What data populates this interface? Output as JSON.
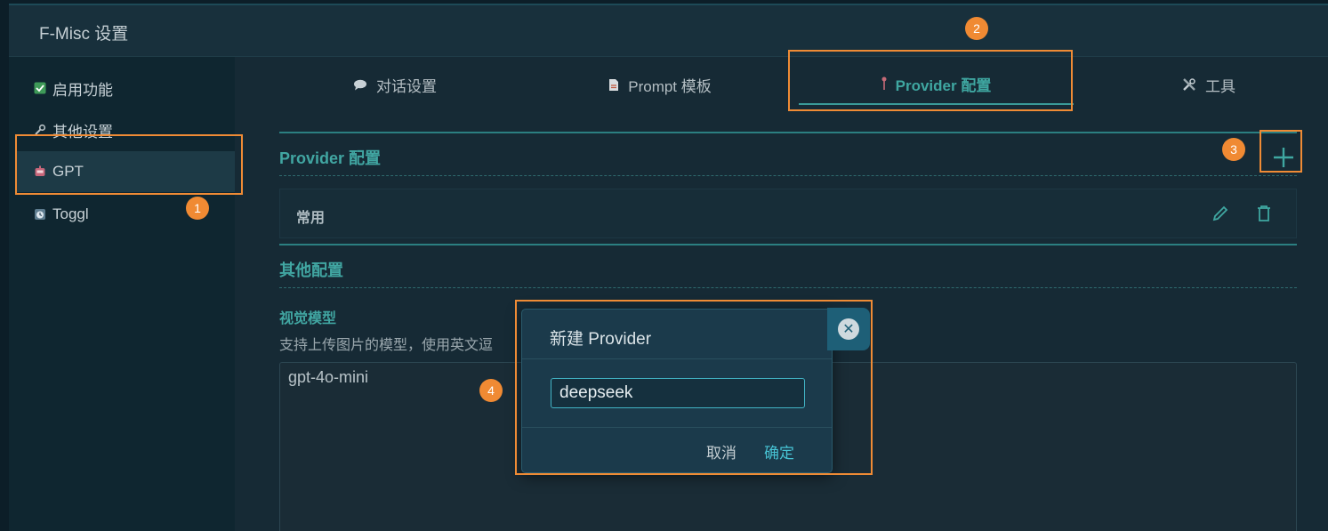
{
  "window": {
    "title": "F-Misc 设置"
  },
  "sidebar": {
    "items": [
      {
        "label": "启用功能",
        "icon": "checkbox-icon"
      },
      {
        "label": "其他设置",
        "icon": "wrench-icon"
      },
      {
        "label": "GPT",
        "icon": "robot-icon",
        "active": true
      },
      {
        "label": "Toggl",
        "icon": "clock-icon"
      }
    ]
  },
  "tabs": [
    {
      "label": "对话设置",
      "icon": "speech-bubble-icon"
    },
    {
      "label": "Prompt 模板",
      "icon": "document-icon"
    },
    {
      "label": "Provider 配置",
      "icon": "key-icon",
      "active": true
    },
    {
      "label": "工具",
      "icon": "tools-icon"
    }
  ],
  "provider_section": {
    "title": "Provider 配置",
    "providers": [
      {
        "name": "常用"
      }
    ]
  },
  "other_section": {
    "title": "其他配置",
    "vision_model": {
      "label": "视觉模型",
      "description": "支持上传图片的模型，使用英文逗",
      "value": "gpt-4o-mini"
    }
  },
  "dialog": {
    "title": "新建 Provider",
    "input_value": "deepseek",
    "cancel_label": "取消",
    "confirm_label": "确定"
  },
  "annotations": [
    "1",
    "2",
    "3",
    "4"
  ],
  "colors": {
    "accent": "#41a6a2",
    "highlight": "#ef8b35",
    "background": "#152a35"
  }
}
